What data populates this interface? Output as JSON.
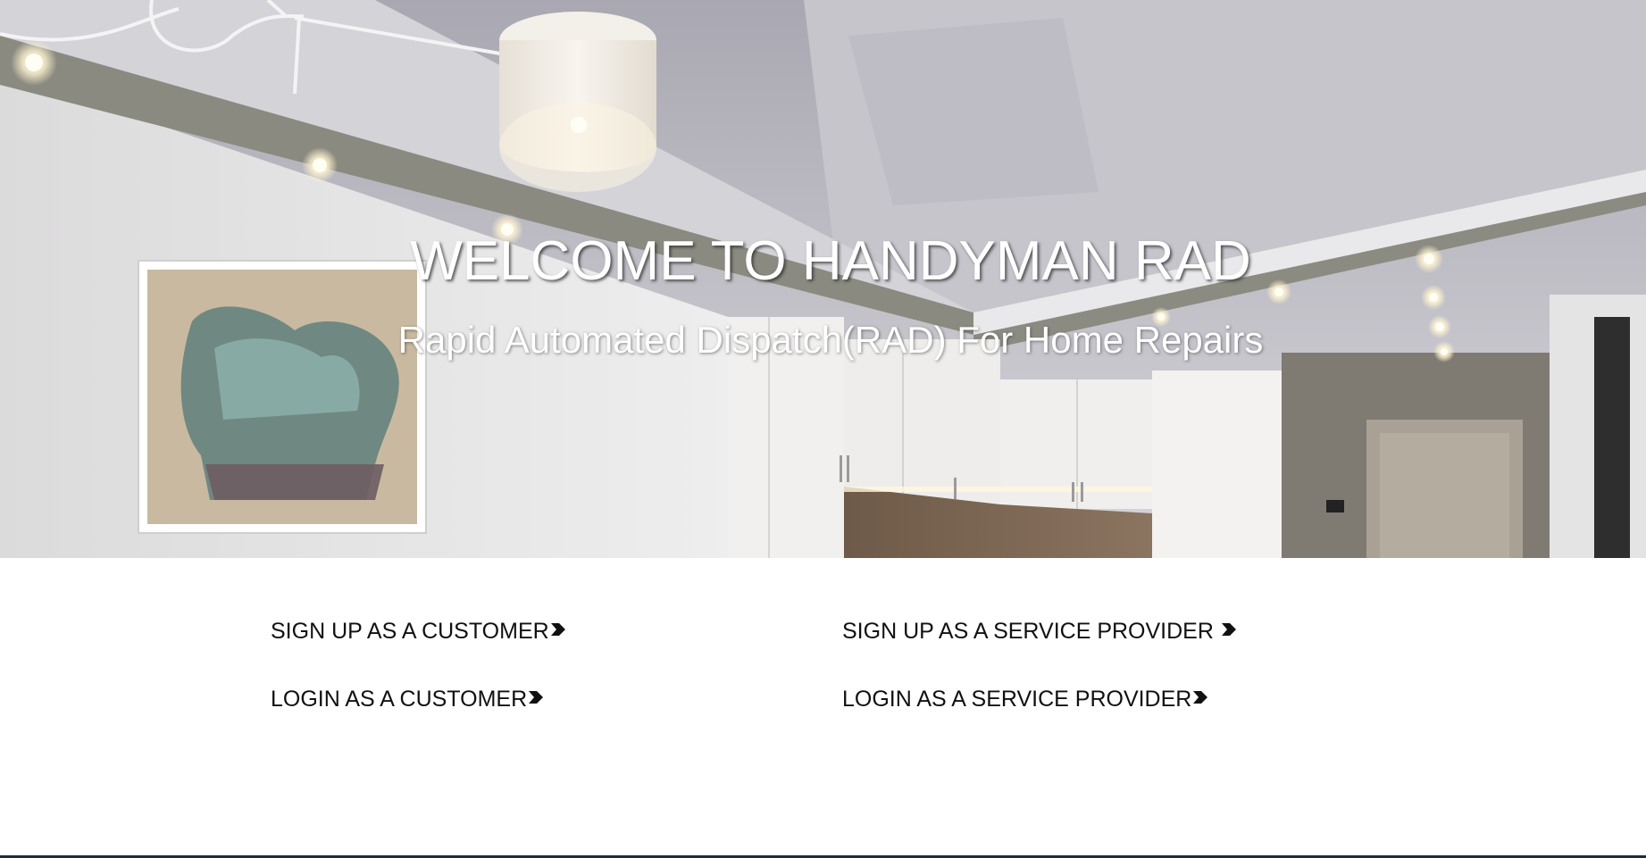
{
  "hero": {
    "title": "WELCOME TO HANDYMAN RAD",
    "subtitle": "Rapid Automated Dispatch(RAD) For Home Repairs",
    "background": "interior-kitchen-photo"
  },
  "links": {
    "signup_customer": "SIGN UP AS A CUSTOMER",
    "signup_provider": "SIGN UP AS A SERVICE PROVIDER",
    "login_customer": "LOGIN AS A CUSTOMER",
    "login_provider": "LOGIN AS A SERVICE PROVIDER",
    "arrow_icon": "chevron-right-icon"
  },
  "colors": {
    "link_text": "#111111",
    "title_text": "#ffffff",
    "footer_line": "#1d2d3a"
  }
}
